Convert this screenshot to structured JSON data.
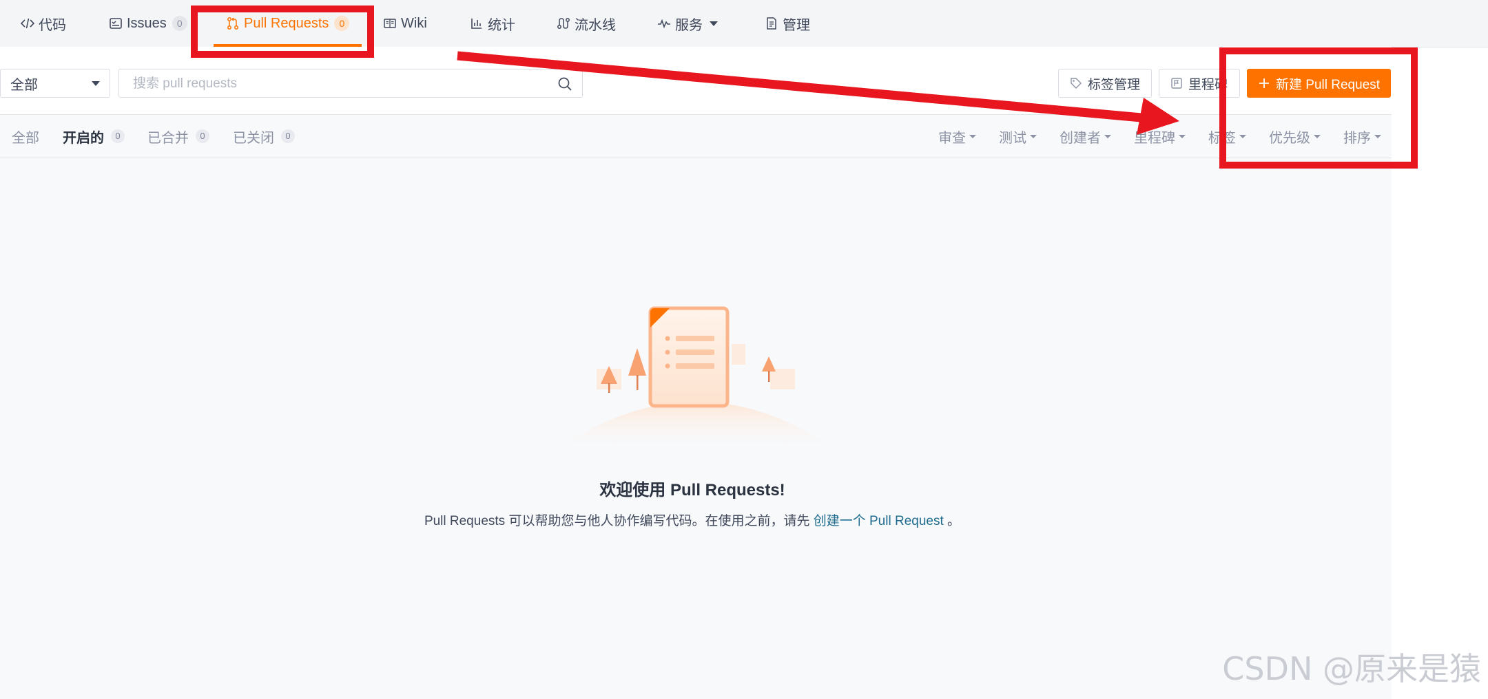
{
  "tabs": [
    {
      "label": "代码",
      "icon": "code-icon"
    },
    {
      "label": "Issues",
      "icon": "issues-icon",
      "count": "0"
    },
    {
      "label": "Pull Requests",
      "icon": "pull-request-icon",
      "count": "0",
      "active": true
    },
    {
      "label": "Wiki",
      "icon": "book-icon"
    },
    {
      "label": "统计",
      "icon": "chart-icon"
    },
    {
      "label": "流水线",
      "icon": "pipeline-icon"
    },
    {
      "label": "服务",
      "icon": "pulse-icon",
      "dropdown": true
    },
    {
      "label": "管理",
      "icon": "manage-icon"
    }
  ],
  "toolbar": {
    "scope_select": "全部",
    "search_placeholder": "搜索 pull requests",
    "label_manage": "标签管理",
    "milestone": "里程碑",
    "new_pr": "新建 Pull Request"
  },
  "filters": {
    "tabs": [
      {
        "label": "全部"
      },
      {
        "label": "开启的",
        "count": "0",
        "active": true
      },
      {
        "label": "已合并",
        "count": "0"
      },
      {
        "label": "已关闭",
        "count": "0"
      }
    ],
    "dropdowns": [
      "审查",
      "测试",
      "创建者",
      "里程碑",
      "标签",
      "优先级",
      "排序"
    ]
  },
  "empty": {
    "title": "欢迎使用 Pull Requests!",
    "desc_before": "Pull Requests 可以帮助您与他人协作编写代码。在使用之前，请先",
    "link": "创建一个 Pull Request",
    "desc_after": "。"
  },
  "watermark": "CSDN @原来是猿",
  "colors": {
    "accent": "#fe7300",
    "annotation": "#e8161e",
    "link": "#1f6c8f"
  }
}
